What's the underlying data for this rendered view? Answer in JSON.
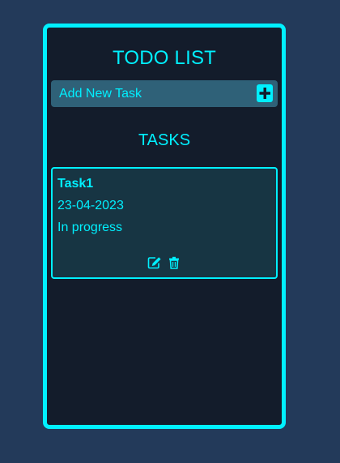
{
  "app": {
    "title": "TODO LIST",
    "accent_color": "#00f0ff"
  },
  "add_task": {
    "label": "Add New Task",
    "button_icon": "plus-square-icon"
  },
  "tasks_section": {
    "heading": "TASKS",
    "tasks": [
      {
        "name": "Task1",
        "date": "23-04-2023",
        "status": "In progress",
        "actions": [
          "edit-icon",
          "trash-icon"
        ]
      }
    ]
  }
}
